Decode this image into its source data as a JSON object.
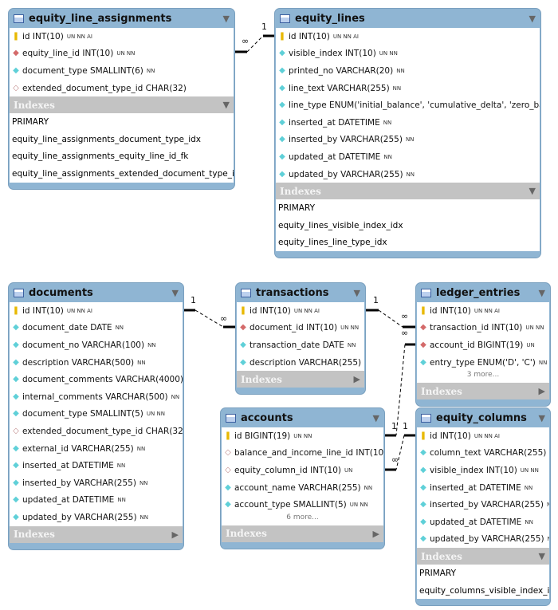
{
  "tables": [
    {
      "id": "equity_line_assignments",
      "title": "equity_line_assignments",
      "indexes_expanded": true,
      "columns": [
        {
          "icon": "key",
          "name": "id INT(10)",
          "flags": "UN NN AI"
        },
        {
          "icon": "fk",
          "name": "equity_line_id INT(10)",
          "flags": "UN NN"
        },
        {
          "icon": "col",
          "name": "document_type SMALLINT(6)",
          "flags": "NN"
        },
        {
          "icon": "nullable",
          "name": "extended_document_type_id CHAR(32)",
          "flags": ""
        }
      ],
      "indexes_label": "Indexes",
      "indexes": [
        "PRIMARY",
        "equity_line_assignments_document_type_idx",
        "equity_line_assignments_equity_line_id_fk",
        "equity_line_assignments_extended_document_type_id_fk"
      ]
    },
    {
      "id": "equity_lines",
      "title": "equity_lines",
      "indexes_expanded": true,
      "columns": [
        {
          "icon": "key",
          "name": "id INT(10)",
          "flags": "UN NN AI"
        },
        {
          "icon": "col",
          "name": "visible_index INT(10)",
          "flags": "UN NN"
        },
        {
          "icon": "col",
          "name": "printed_no VARCHAR(20)",
          "flags": "NN"
        },
        {
          "icon": "col",
          "name": "line_text VARCHAR(255)",
          "flags": "NN"
        },
        {
          "icon": "col",
          "name": "line_type ENUM('initial_balance', 'cumulative_delta', 'zero_balan...",
          "flags": ""
        },
        {
          "icon": "col",
          "name": "inserted_at DATETIME",
          "flags": "NN"
        },
        {
          "icon": "col",
          "name": "inserted_by VARCHAR(255)",
          "flags": "NN"
        },
        {
          "icon": "col",
          "name": "updated_at DATETIME",
          "flags": "NN"
        },
        {
          "icon": "col",
          "name": "updated_by VARCHAR(255)",
          "flags": "NN"
        }
      ],
      "indexes_label": "Indexes",
      "indexes": [
        "PRIMARY",
        "equity_lines_visible_index_idx",
        "equity_lines_line_type_idx"
      ]
    },
    {
      "id": "documents",
      "title": "documents",
      "indexes_expanded": false,
      "columns": [
        {
          "icon": "key",
          "name": "id INT(10)",
          "flags": "UN NN AI"
        },
        {
          "icon": "col",
          "name": "document_date DATE",
          "flags": "NN"
        },
        {
          "icon": "col",
          "name": "document_no VARCHAR(100)",
          "flags": "NN"
        },
        {
          "icon": "col",
          "name": "description VARCHAR(500)",
          "flags": "NN"
        },
        {
          "icon": "col",
          "name": "document_comments VARCHAR(4000)",
          "flags": "NN"
        },
        {
          "icon": "col",
          "name": "internal_comments VARCHAR(500)",
          "flags": "NN"
        },
        {
          "icon": "col",
          "name": "document_type SMALLINT(5)",
          "flags": "UN NN"
        },
        {
          "icon": "nullable",
          "name": "extended_document_type_id CHAR(32)",
          "flags": ""
        },
        {
          "icon": "col",
          "name": "external_id VARCHAR(255)",
          "flags": "NN"
        },
        {
          "icon": "col",
          "name": "inserted_at DATETIME",
          "flags": "NN"
        },
        {
          "icon": "col",
          "name": "inserted_by VARCHAR(255)",
          "flags": "NN"
        },
        {
          "icon": "col",
          "name": "updated_at DATETIME",
          "flags": "NN"
        },
        {
          "icon": "col",
          "name": "updated_by VARCHAR(255)",
          "flags": "NN"
        }
      ],
      "indexes_label": "Indexes",
      "indexes": []
    },
    {
      "id": "transactions",
      "title": "transactions",
      "indexes_expanded": false,
      "columns": [
        {
          "icon": "key",
          "name": "id INT(10)",
          "flags": "UN NN AI"
        },
        {
          "icon": "fk",
          "name": "document_id INT(10)",
          "flags": "UN NN"
        },
        {
          "icon": "col",
          "name": "transaction_date DATE",
          "flags": "NN"
        },
        {
          "icon": "col",
          "name": "description VARCHAR(255)",
          "flags": "NN"
        }
      ],
      "indexes_label": "Indexes",
      "indexes": []
    },
    {
      "id": "ledger_entries",
      "title": "ledger_entries",
      "indexes_expanded": false,
      "columns": [
        {
          "icon": "key",
          "name": "id INT(10)",
          "flags": "UN NN AI"
        },
        {
          "icon": "fk",
          "name": "transaction_id INT(10)",
          "flags": "UN NN"
        },
        {
          "icon": "fk",
          "name": "account_id BIGINT(19)",
          "flags": "UN"
        },
        {
          "icon": "col",
          "name": "entry_type ENUM('D', 'C')",
          "flags": "NN"
        }
      ],
      "more": "3 more...",
      "indexes_label": "Indexes",
      "indexes": []
    },
    {
      "id": "accounts",
      "title": "accounts",
      "indexes_expanded": false,
      "columns": [
        {
          "icon": "key",
          "name": "id BIGINT(19)",
          "flags": "UN NN"
        },
        {
          "icon": "nullable",
          "name": "balance_and_income_line_id INT(10)",
          "flags": ""
        },
        {
          "icon": "nullable",
          "name": "equity_column_id INT(10)",
          "flags": "UN"
        },
        {
          "icon": "col",
          "name": "account_name VARCHAR(255)",
          "flags": "NN"
        },
        {
          "icon": "col",
          "name": "account_type SMALLINT(5)",
          "flags": "UN NN"
        }
      ],
      "more": "6 more...",
      "indexes_label": "Indexes",
      "indexes": []
    },
    {
      "id": "equity_columns",
      "title": "equity_columns",
      "indexes_expanded": true,
      "columns": [
        {
          "icon": "key",
          "name": "id INT(10)",
          "flags": "UN NN AI"
        },
        {
          "icon": "col",
          "name": "column_text VARCHAR(255)",
          "flags": "NN"
        },
        {
          "icon": "col",
          "name": "visible_index INT(10)",
          "flags": "UN NN"
        },
        {
          "icon": "col",
          "name": "inserted_at DATETIME",
          "flags": "NN"
        },
        {
          "icon": "col",
          "name": "inserted_by VARCHAR(255)",
          "flags": "NN"
        },
        {
          "icon": "col",
          "name": "updated_at DATETIME",
          "flags": "NN"
        },
        {
          "icon": "col",
          "name": "updated_by VARCHAR(255)",
          "flags": "NN"
        }
      ],
      "indexes_label": "Indexes",
      "indexes": [
        "PRIMARY",
        "equity_columns_visible_index_idx"
      ]
    }
  ],
  "relationships": [
    {
      "from": "equity_line_assignments",
      "to": "equity_lines",
      "from_card": "∞",
      "to_card": "1"
    },
    {
      "from": "transactions",
      "to": "documents",
      "from_card": "∞",
      "to_card": "1"
    },
    {
      "from": "ledger_entries",
      "to": "transactions",
      "from_card": "∞",
      "to_card": "1"
    },
    {
      "from": "ledger_entries",
      "to": "accounts",
      "from_card": "∞",
      "to_card": "1"
    },
    {
      "from": "accounts",
      "to": "equity_columns",
      "from_card": "∞",
      "to_card": "1"
    }
  ]
}
